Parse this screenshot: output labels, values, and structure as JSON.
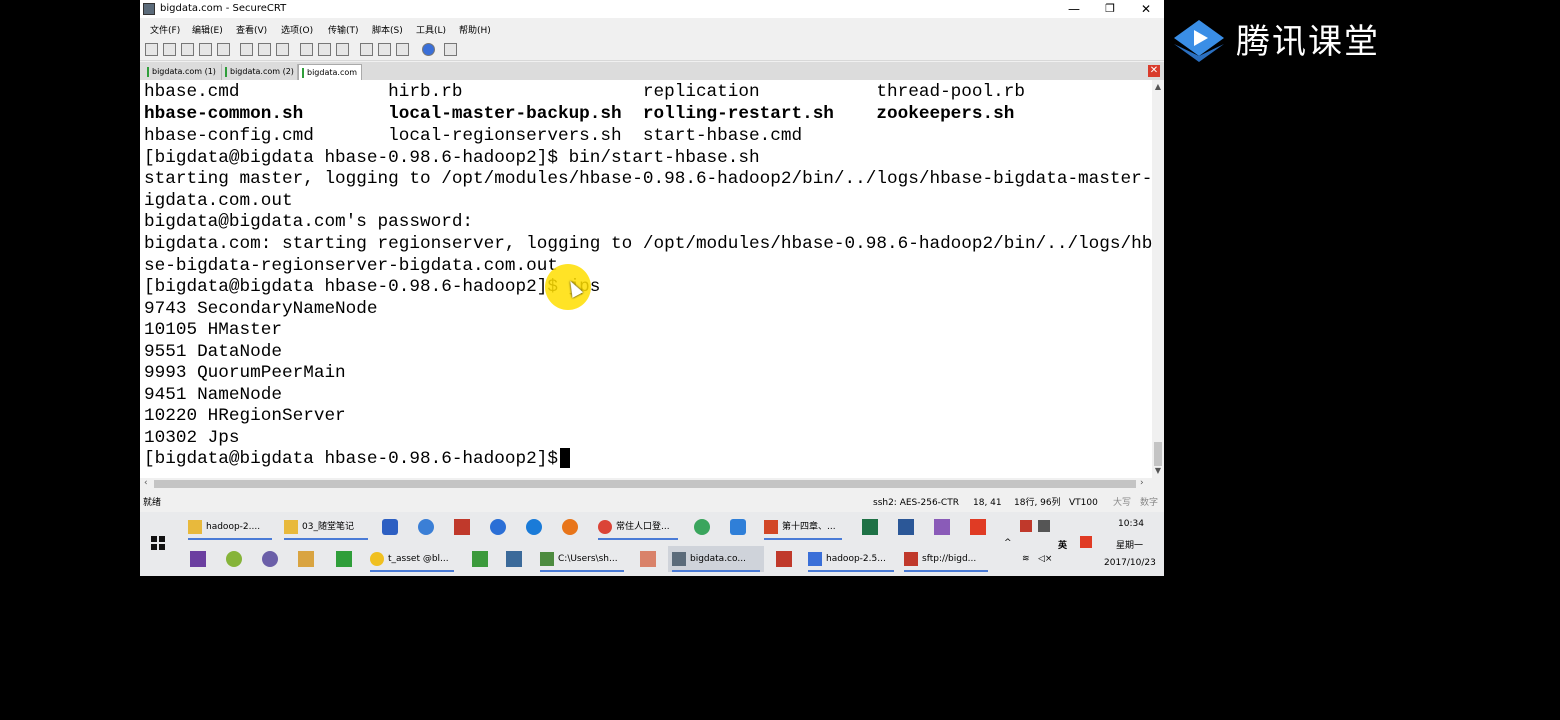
{
  "window": {
    "title": "bigdata.com - SecureCRT"
  },
  "menubar": [
    "文件(F)",
    "编辑(E)",
    "查看(V)",
    "选项(O)",
    "传输(T)",
    "脚本(S)",
    "工具(L)",
    "帮助(H)"
  ],
  "tabs": [
    "bigdata.com (1)",
    "bigdata.com (2)",
    "bigdata.com"
  ],
  "terminal": {
    "lines": [
      "hbase.cmd              hirb.rb                 replication           thread-pool.rb",
      "hbase-common.sh        local-master-backup.sh  rolling-restart.sh    zookeepers.sh",
      "hbase-config.cmd       local-regionservers.sh  start-hbase.cmd",
      "[bigdata@bigdata hbase-0.98.6-hadoop2]$ bin/start-hbase.sh",
      "starting master, logging to /opt/modules/hbase-0.98.6-hadoop2/bin/../logs/hbase-bigdata-master-b",
      "igdata.com.out",
      "bigdata@bigdata.com's password:",
      "bigdata.com: starting regionserver, logging to /opt/modules/hbase-0.98.6-hadoop2/bin/../logs/hba",
      "se-bigdata-regionserver-bigdata.com.out",
      "[bigdata@bigdata hbase-0.98.6-hadoop2]$ jps",
      "9743 SecondaryNameNode",
      "10105 HMaster",
      "9551 DataNode",
      "9993 QuorumPeerMain",
      "9451 NameNode",
      "10220 HRegionServer",
      "10302 Jps",
      "[bigdata@bigdata hbase-0.98.6-hadoop2]$ "
    ]
  },
  "statusbar": {
    "ready": "就绪",
    "connection": "ssh2: AES-256-CTR",
    "cursor": "18, 41",
    "size": "18行, 96列",
    "emulation": "VT100",
    "caps": "大写",
    "num": "数字"
  },
  "taskbar": {
    "row1": [
      "hadoop-2....",
      "03_随堂笔记",
      "常住人口登...",
      "第十四章、..."
    ],
    "row2": [
      "t_asset @bl...",
      "C:\\Users\\sh...",
      "bigdata.co...",
      "hadoop-2.5...",
      "sftp://bigd..."
    ],
    "time": "10:34",
    "weekday": "星期一",
    "date": "2017/10/23",
    "ime": "英"
  },
  "brand": {
    "text": "腾讯课堂"
  },
  "colors": {
    "accent_yellow": "#ffde00",
    "brand_blue": "#3a8ee6",
    "tab_close_red": "#d93b2b"
  }
}
